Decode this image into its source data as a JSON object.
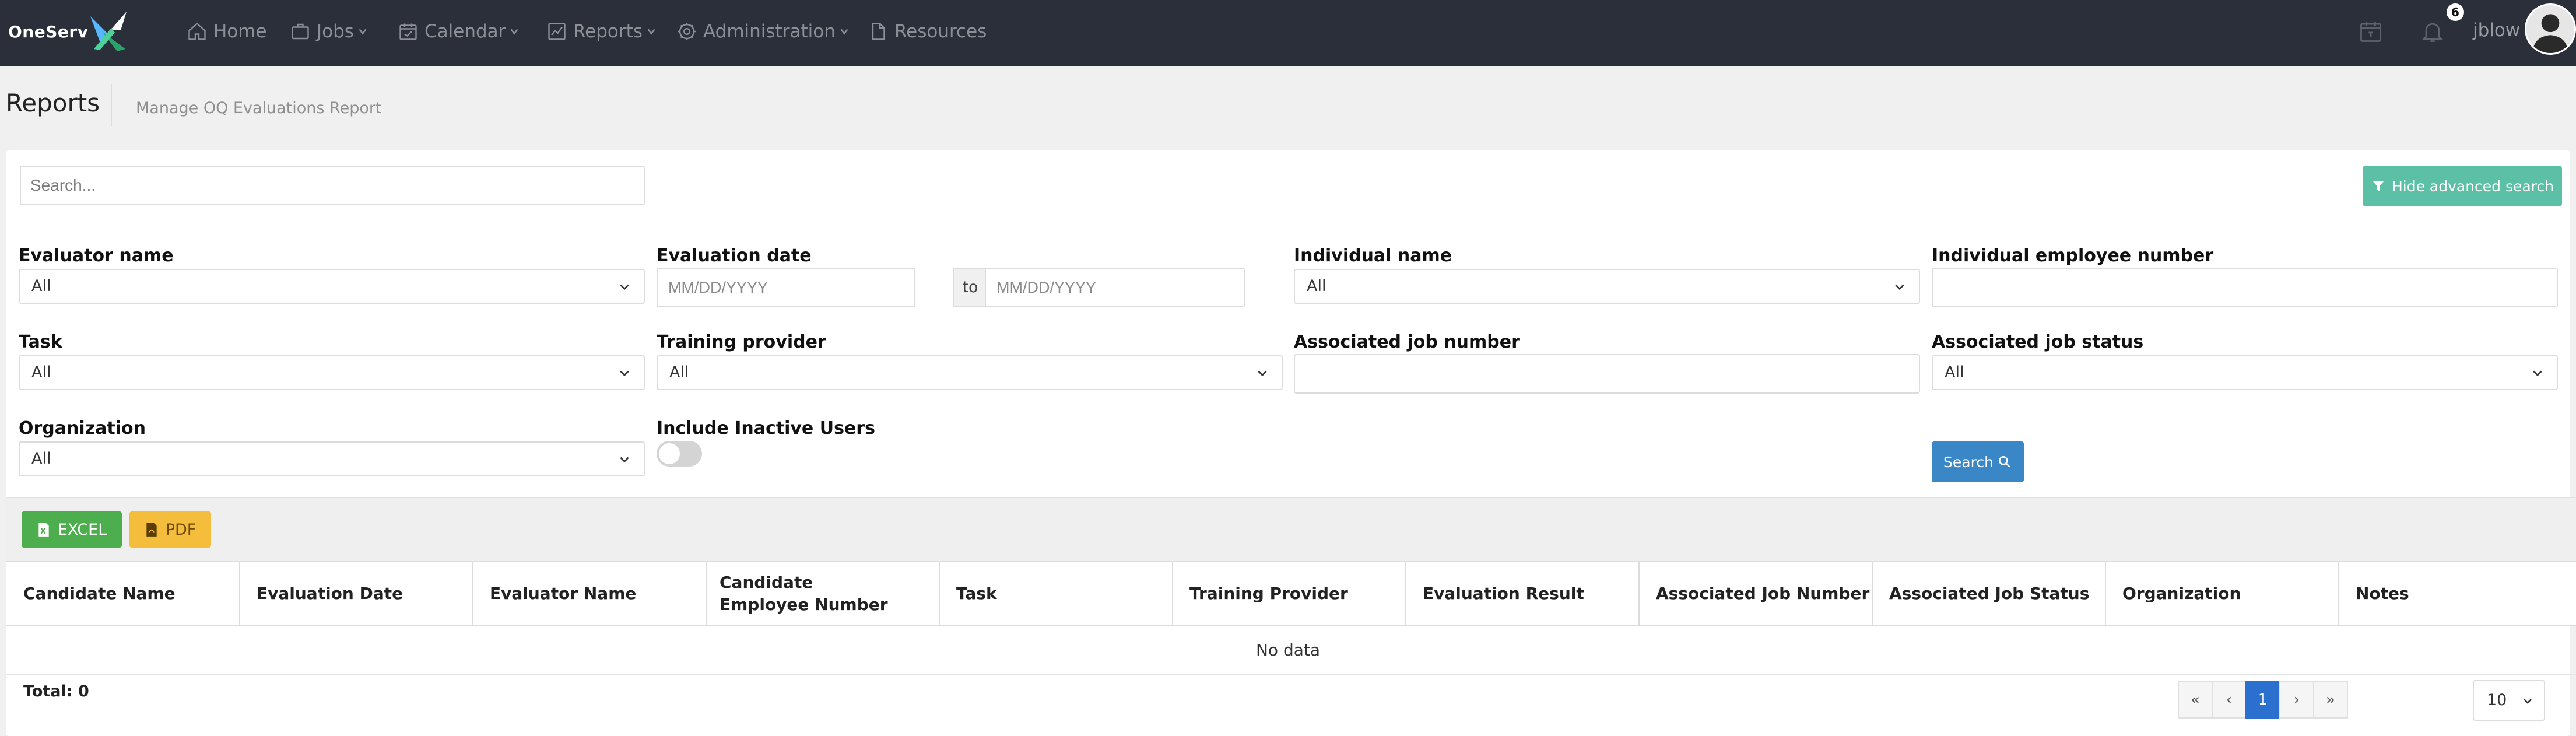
{
  "brand": {
    "name": "OneServ"
  },
  "nav": {
    "items": [
      {
        "label": "Home",
        "icon": "home-icon"
      },
      {
        "label": "Jobs",
        "icon": "briefcase-icon"
      },
      {
        "label": "Calendar",
        "icon": "calendar-icon"
      },
      {
        "label": "Reports",
        "icon": "chart-icon"
      },
      {
        "label": "Administration",
        "icon": "gear-icon"
      },
      {
        "label": "Resources",
        "icon": "document-icon"
      }
    ],
    "notification_count": "6",
    "username": "jblow"
  },
  "header": {
    "title": "Reports",
    "subtitle": "Manage OQ Evaluations Report"
  },
  "search": {
    "placeholder": "Search..."
  },
  "advanced_search_button": "Hide advanced search",
  "filters": {
    "evaluator_name": {
      "label": "Evaluator name",
      "value": "All"
    },
    "evaluation_date": {
      "label": "Evaluation date",
      "from_placeholder": "MM/DD/YYYY",
      "to_label": "to",
      "to_placeholder": "MM/DD/YYYY"
    },
    "individual_name": {
      "label": "Individual name",
      "value": "All"
    },
    "individual_employee_number": {
      "label": "Individual employee number",
      "value": ""
    },
    "task": {
      "label": "Task",
      "value": "All"
    },
    "training_provider": {
      "label": "Training provider",
      "value": "All"
    },
    "associated_job_number": {
      "label": "Associated job number",
      "value": ""
    },
    "associated_job_status": {
      "label": "Associated job status",
      "value": "All"
    },
    "organization": {
      "label": "Organization",
      "value": "All"
    },
    "include_inactive_users": {
      "label": "Include Inactive Users",
      "enabled": false
    }
  },
  "search_button": "Search",
  "export": {
    "excel": "EXCEL",
    "pdf": "PDF"
  },
  "table": {
    "columns": [
      {
        "label": "Candidate Name"
      },
      {
        "label": "Evaluation Date"
      },
      {
        "label": "Evaluator Name"
      },
      {
        "label": "Candidate Employee Number"
      },
      {
        "label": "Task"
      },
      {
        "label": "Training Provider"
      },
      {
        "label": "Evaluation Result"
      },
      {
        "label": "Associated Job Number"
      },
      {
        "label": "Associated Job Status"
      },
      {
        "label": "Organization"
      },
      {
        "label": "Notes"
      }
    ],
    "empty_text": "No data"
  },
  "footer": {
    "total": "Total: 0",
    "pager": {
      "first": "«",
      "prev": "‹",
      "current": "1",
      "next": "›",
      "last": "»"
    },
    "page_size": "10"
  },
  "colors": {
    "topbar": "#2b2f3a",
    "accent_green": "#5bc0a5",
    "primary_blue": "#3a87c8",
    "excel_green": "#4cae4c",
    "pdf_yellow": "#f5bd3c",
    "page_active": "#2b6fcf"
  }
}
